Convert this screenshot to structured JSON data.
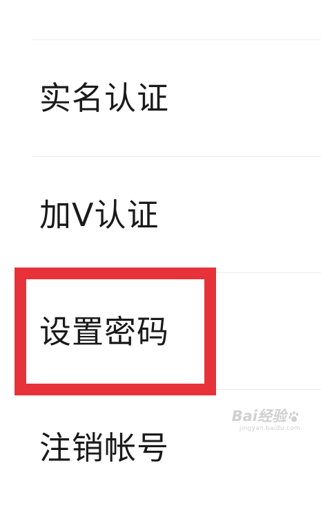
{
  "menu": {
    "items": [
      {
        "label": "实名认证"
      },
      {
        "label": "加V认证"
      },
      {
        "label": "设置密码"
      },
      {
        "label": "注销帐号"
      }
    ]
  },
  "annotation": {
    "highlight_color": "#e8323a",
    "highlighted_item": "设置密码"
  },
  "watermark": {
    "logo_text": "Bai经验",
    "url": "jingyan.baidu.com",
    "icon": "baidu-paw-icon"
  }
}
